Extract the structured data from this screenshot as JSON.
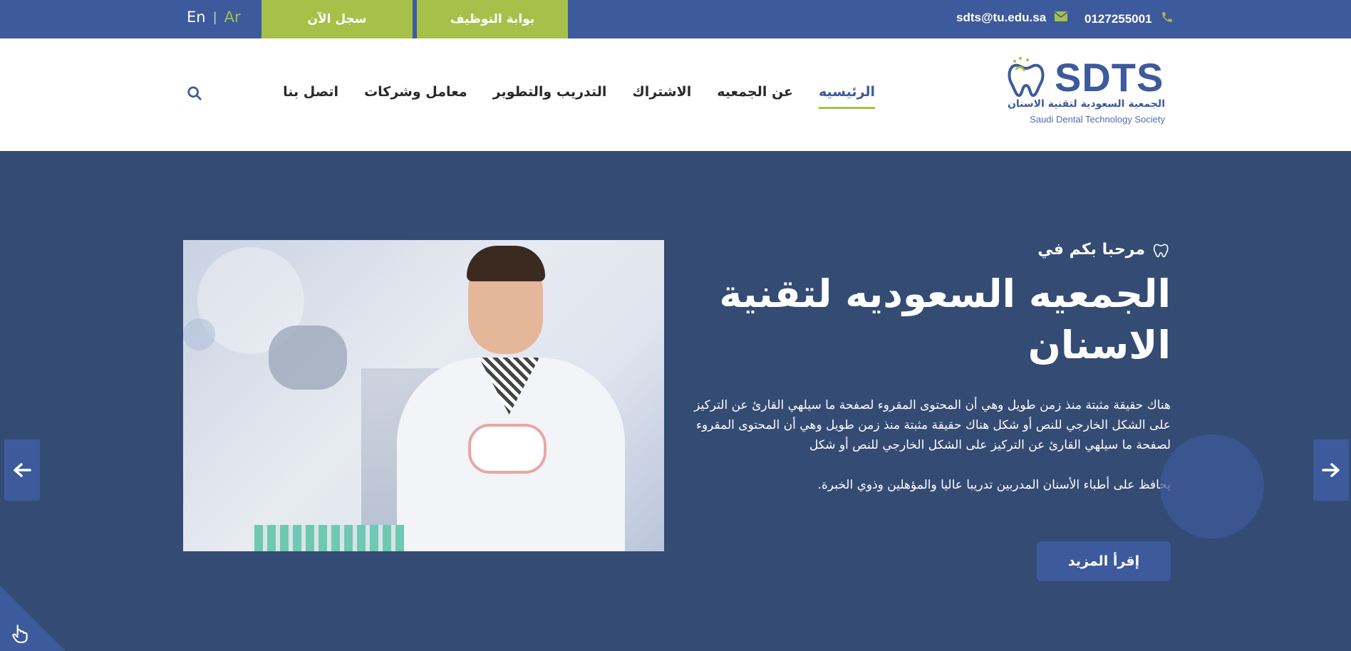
{
  "topbar": {
    "lang_en": "En",
    "lang_sep": "|",
    "lang_ar": "Ar",
    "register_label": "سجل الآن",
    "jobs_label": "بوابة التوظيف",
    "email": "sdts@tu.edu.sa",
    "phone": "0127255001"
  },
  "logo": {
    "brand": "SDTS",
    "ar_name": "الجمعية السعودية لتقنية الاسنان",
    "en_name": "Saudi Dental Technology Society"
  },
  "nav": {
    "items": [
      {
        "label": "الرئيسيه",
        "active": true
      },
      {
        "label": "عن الجمعيه"
      },
      {
        "label": "الاشتراك"
      },
      {
        "label": "التدريب والتطوير"
      },
      {
        "label": "معامل وشركات"
      },
      {
        "label": "اتصل بنا"
      }
    ]
  },
  "hero": {
    "welcome": "مرحبا بكم في",
    "title": "الجمعيه السعوديه لتقنية الاسنان",
    "paragraph": "هناك حقيقة مثبتة منذ زمن طويل وهي أن المحتوى المقروء لصفحة ما سيلهي القارئ عن التركيز على الشكل الخارجي للنص أو شكل هناك حقيقة مثبتة منذ زمن طويل وهي أن المحتوى المقروء لصفحة ما سيلهي القارئ عن التركيز على الشكل الخارجي للنص أو شكل",
    "paragraph2": "يحافظ على أطباء الأسنان المدربين تدريبا عاليا والمؤهلين وذوي الخبرة.",
    "button": "إقرأ المزيد"
  },
  "colors": {
    "primary": "#3d5a9c",
    "accent": "#a7c04a",
    "hero_bg": "#344b74"
  }
}
